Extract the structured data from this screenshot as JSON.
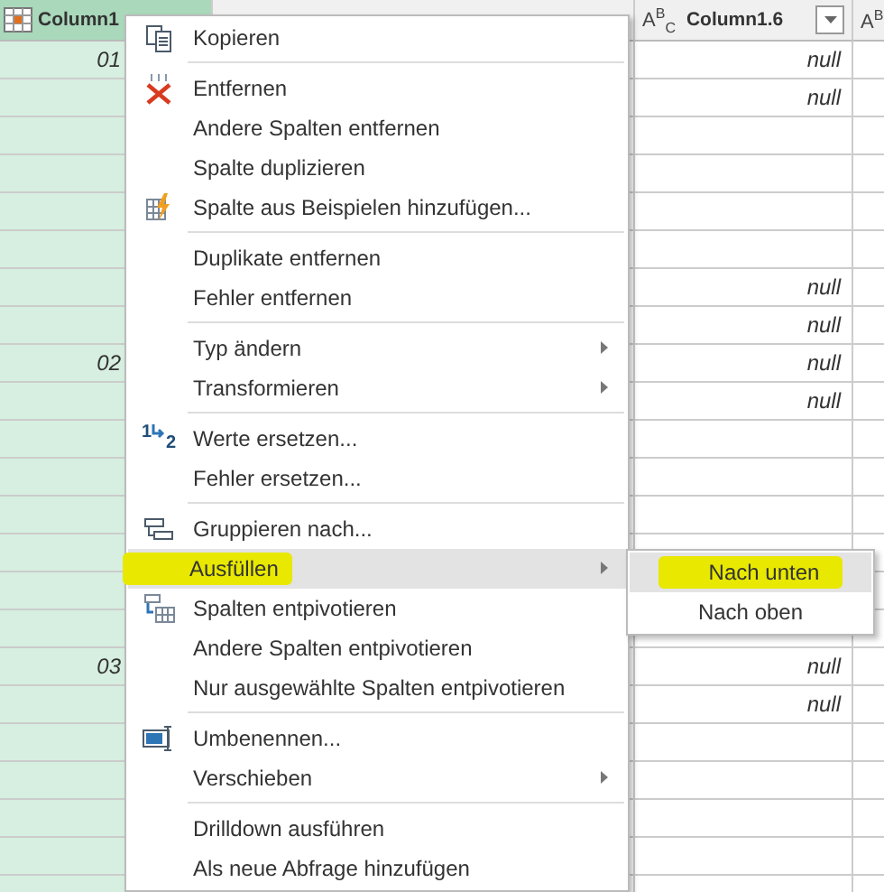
{
  "table": {
    "columns": [
      {
        "label": "Column1",
        "selected": true
      },
      {
        "selected": false
      },
      {
        "label": "Column1.6",
        "type_label": "A$^{B}$$_{C}$",
        "selected": false
      },
      {
        "type_label": "A$^{B}$",
        "selected": false
      }
    ],
    "rows": [
      {
        "column1": "01",
        "column1_6": "null"
      },
      {
        "column1_6": "null"
      },
      {},
      {},
      {},
      {},
      {
        "column1_6": "null"
      },
      {
        "column1_6": "null"
      },
      {
        "column1": "02",
        "column1_6": "null"
      },
      {
        "column1_6": "null"
      },
      {},
      {},
      {},
      {},
      {},
      {},
      {
        "column1": "03",
        "column1_6": "null"
      },
      {
        "column1_6": "null"
      },
      {},
      {},
      {},
      {},
      {}
    ]
  },
  "context_menu": {
    "items": [
      {
        "kind": "item",
        "label": "Kopieren",
        "has_submenu": false,
        "selected": false,
        "marked": false
      },
      {
        "kind": "separator"
      },
      {
        "kind": "item",
        "label": "Entfernen",
        "has_submenu": false,
        "selected": false,
        "marked": false
      },
      {
        "kind": "item",
        "label": "Andere Spalten entfernen",
        "has_submenu": false,
        "selected": false,
        "marked": false
      },
      {
        "kind": "item",
        "label": "Spalte duplizieren",
        "has_submenu": false,
        "selected": false,
        "marked": false
      },
      {
        "kind": "item",
        "label": "Spalte aus Beispielen hinzufügen...",
        "has_submenu": false,
        "selected": false,
        "marked": false
      },
      {
        "kind": "separator"
      },
      {
        "kind": "item",
        "label": "Duplikate entfernen",
        "has_submenu": false,
        "selected": false,
        "marked": false
      },
      {
        "kind": "item",
        "label": "Fehler entfernen",
        "has_submenu": false,
        "selected": false,
        "marked": false
      },
      {
        "kind": "separator"
      },
      {
        "kind": "item",
        "label": "Typ ändern",
        "has_submenu": true,
        "selected": false,
        "marked": false
      },
      {
        "kind": "item",
        "label": "Transformieren",
        "has_submenu": true,
        "selected": false,
        "marked": false
      },
      {
        "kind": "separator"
      },
      {
        "kind": "item",
        "label": "Werte ersetzen...",
        "icon_digits": [
          "1",
          "2"
        ],
        "has_submenu": false,
        "selected": false,
        "marked": false
      },
      {
        "kind": "item",
        "label": "Fehler ersetzen...",
        "has_submenu": false,
        "selected": false,
        "marked": false
      },
      {
        "kind": "separator"
      },
      {
        "kind": "item",
        "label": "Gruppieren nach...",
        "has_submenu": false,
        "selected": false,
        "marked": false
      },
      {
        "kind": "item",
        "label": "Ausfüllen",
        "has_submenu": true,
        "selected": true,
        "marked": true
      },
      {
        "kind": "item",
        "label": "Spalten entpivotieren",
        "has_submenu": false,
        "selected": false,
        "marked": false
      },
      {
        "kind": "item",
        "label": "Andere Spalten entpivotieren",
        "has_submenu": false,
        "selected": false,
        "marked": false
      },
      {
        "kind": "item",
        "label": "Nur ausgewählte Spalten entpivotieren",
        "has_submenu": false,
        "selected": false,
        "marked": false
      },
      {
        "kind": "separator"
      },
      {
        "kind": "item",
        "label": "Umbenennen...",
        "has_submenu": false,
        "selected": false,
        "marked": false
      },
      {
        "kind": "item",
        "label": "Verschieben",
        "has_submenu": true,
        "selected": false,
        "marked": false
      },
      {
        "kind": "separator"
      },
      {
        "kind": "item",
        "label": "Drilldown ausführen",
        "has_submenu": false,
        "selected": false,
        "marked": false
      },
      {
        "kind": "item",
        "label": "Als neue Abfrage hinzufügen",
        "has_submenu": false,
        "selected": false,
        "marked": false
      }
    ]
  },
  "submenu": {
    "items": [
      {
        "label": "Nach unten",
        "selected": true,
        "marked": true
      },
      {
        "label": "Nach oben",
        "selected": false,
        "marked": false
      }
    ]
  }
}
